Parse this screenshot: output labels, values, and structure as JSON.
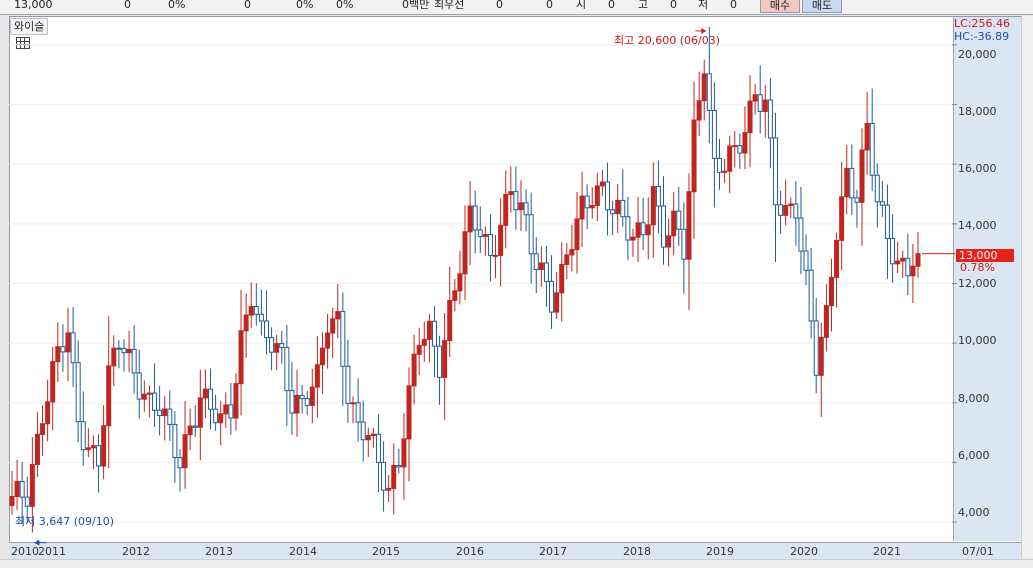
{
  "topbar": {
    "fields": [
      "13,000",
      "0",
      "0%",
      "0",
      "0%",
      "0%",
      "0백만",
      "최우선",
      "0",
      "0",
      "시",
      "0",
      "고",
      "0",
      "저",
      "0"
    ],
    "buy_label": "매수",
    "sell_label": "매도"
  },
  "chart": {
    "indicator_tab": "와이슬",
    "lc_label": "LC:256.46",
    "hc_label": "HC:-36.89",
    "current_price": "13,000",
    "change_percent": "0.78%",
    "high_annotation": "최고 20,600 (06/03)",
    "low_annotation": "최저 3,647 (09/10)",
    "colors": {
      "up": "#c0261f",
      "down": "#1e5d9c",
      "accent": "#e8231b",
      "axis_bg": "#dce6f2"
    }
  },
  "chart_data": {
    "type": "candlestick",
    "y_axis": {
      "ticks": [
        4000,
        6000,
        8000,
        10000,
        12000,
        14000,
        16000,
        18000,
        20000
      ],
      "tick_labels": [
        "4,000",
        "6,000",
        "8,000",
        "10,000",
        "12,000",
        "14,000",
        "16,000",
        "18,000",
        "20,000"
      ],
      "range": [
        3300,
        20900
      ]
    },
    "x_axis": {
      "labels": [
        "2010",
        "2011",
        "2012",
        "2013",
        "2014",
        "2015",
        "2016",
        "2017",
        "2018",
        "2019",
        "2020",
        "2021",
        "07/01"
      ]
    },
    "high": {
      "value": 20600,
      "date": "06/03"
    },
    "low": {
      "value": 3647,
      "date": "09/10"
    },
    "last": {
      "value": 13000,
      "change_percent": 0.78
    },
    "waypoints": [
      [
        0,
        4600
      ],
      [
        3,
        5000
      ],
      [
        6,
        7800
      ],
      [
        9,
        9500
      ],
      [
        11,
        10200
      ],
      [
        13,
        7500
      ],
      [
        15,
        6600
      ],
      [
        17,
        6200
      ],
      [
        19,
        8700
      ],
      [
        21,
        10000
      ],
      [
        24,
        9200
      ],
      [
        27,
        8000
      ],
      [
        29,
        7700
      ],
      [
        31,
        6800
      ],
      [
        33,
        6100
      ],
      [
        35,
        7400
      ],
      [
        37,
        8200
      ],
      [
        39,
        7700
      ],
      [
        41,
        7200
      ],
      [
        43,
        7900
      ],
      [
        45,
        10300
      ],
      [
        47,
        11700
      ],
      [
        49,
        10100
      ],
      [
        51,
        9900
      ],
      [
        53,
        9600
      ],
      [
        55,
        8200
      ],
      [
        57,
        8000
      ],
      [
        60,
        8600
      ],
      [
        62,
        10700
      ],
      [
        64,
        10900
      ],
      [
        66,
        8500
      ],
      [
        68,
        7000
      ],
      [
        70,
        6800
      ],
      [
        72,
        5900
      ],
      [
        74,
        5300
      ],
      [
        76,
        6200
      ],
      [
        78,
        8200
      ],
      [
        80,
        10000
      ],
      [
        82,
        10300
      ],
      [
        84,
        9500
      ],
      [
        86,
        11200
      ],
      [
        88,
        12600
      ],
      [
        90,
        14000
      ],
      [
        92,
        13800
      ],
      [
        94,
        13000
      ],
      [
        96,
        14200
      ],
      [
        98,
        15000
      ],
      [
        100,
        14300
      ],
      [
        102,
        13200
      ],
      [
        104,
        12600
      ],
      [
        106,
        11600
      ],
      [
        108,
        12100
      ],
      [
        110,
        13300
      ],
      [
        112,
        14500
      ],
      [
        114,
        15200
      ],
      [
        116,
        15300
      ],
      [
        118,
        14400
      ],
      [
        120,
        13900
      ],
      [
        122,
        13500
      ],
      [
        124,
        14000
      ],
      [
        126,
        15200
      ],
      [
        128,
        13400
      ],
      [
        130,
        13800
      ],
      [
        132,
        13200
      ],
      [
        134,
        17300
      ],
      [
        136,
        19600
      ],
      [
        138,
        15700
      ],
      [
        140,
        15800
      ],
      [
        142,
        16400
      ],
      [
        144,
        17400
      ],
      [
        146,
        18500
      ],
      [
        148,
        17900
      ],
      [
        150,
        14600
      ],
      [
        152,
        14300
      ],
      [
        154,
        14800
      ],
      [
        156,
        12200
      ],
      [
        158,
        9200
      ],
      [
        160,
        10600
      ],
      [
        162,
        13800
      ],
      [
        164,
        15800
      ],
      [
        166,
        15100
      ],
      [
        168,
        17100
      ],
      [
        170,
        14500
      ],
      [
        172,
        13600
      ],
      [
        174,
        12800
      ],
      [
        176,
        12700
      ],
      [
        178,
        13000
      ]
    ]
  },
  "xaxis": {
    "labels": [
      "2010",
      "2011",
      "2012",
      "2013",
      "2014",
      "2015",
      "2016",
      "2017",
      "2018",
      "2019",
      "2020",
      "2021",
      "07/01"
    ]
  }
}
